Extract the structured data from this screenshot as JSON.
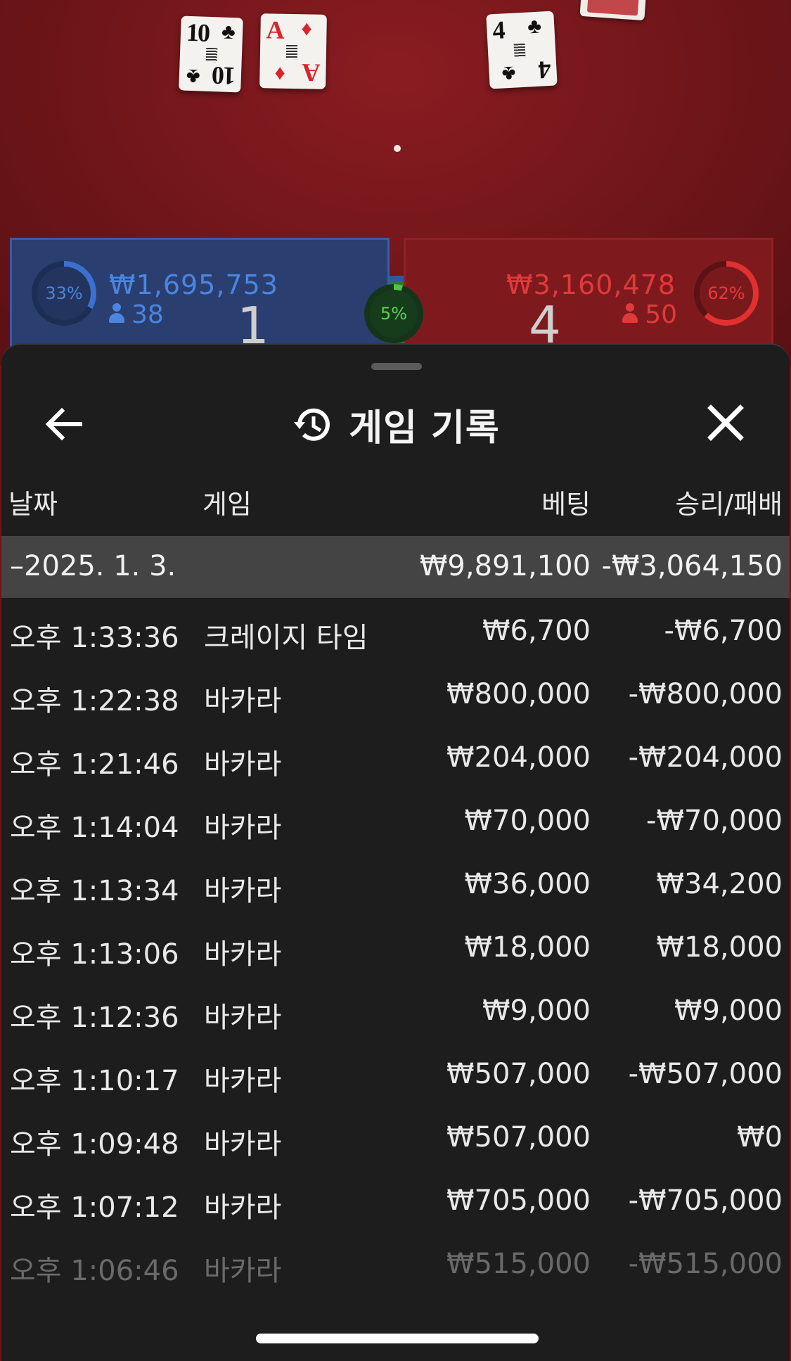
{
  "game": {
    "cards_left": [
      {
        "rank": "10",
        "suit": "♣",
        "color": "black"
      },
      {
        "rank": "A",
        "suit": "♦",
        "color": "red"
      }
    ],
    "cards_right": [
      {
        "rank": "4",
        "suit": "♣",
        "color": "black"
      }
    ],
    "player": {
      "percent": "33%",
      "amount": "₩1,695,753",
      "players": "38",
      "score": "1"
    },
    "tie": {
      "percent": "5%"
    },
    "banker": {
      "percent": "62%",
      "amount": "₩3,160,478",
      "players": "50",
      "score": "4"
    }
  },
  "sheet": {
    "title": "게임 기록",
    "back_icon": "back-arrow-icon",
    "history_icon": "history-icon",
    "close_icon": "close-icon",
    "columns": {
      "date": "날짜",
      "game": "게임",
      "bet": "베팅",
      "result": "승리/패배"
    },
    "summary": {
      "date": "–2025. 1. 3.",
      "bet": "₩9,891,100",
      "result": "-₩3,064,150"
    },
    "rows": [
      {
        "time": "오후 1:33:36",
        "game": "크레이지 타임",
        "bet": "₩6,700",
        "result": "-₩6,700"
      },
      {
        "time": "오후 1:22:38",
        "game": "바카라",
        "bet": "₩800,000",
        "result": "-₩800,000"
      },
      {
        "time": "오후 1:21:46",
        "game": "바카라",
        "bet": "₩204,000",
        "result": "-₩204,000"
      },
      {
        "time": "오후 1:14:04",
        "game": "바카라",
        "bet": "₩70,000",
        "result": "-₩70,000"
      },
      {
        "time": "오후 1:13:34",
        "game": "바카라",
        "bet": "₩36,000",
        "result": "₩34,200"
      },
      {
        "time": "오후 1:13:06",
        "game": "바카라",
        "bet": "₩18,000",
        "result": "₩18,000"
      },
      {
        "time": "오후 1:12:36",
        "game": "바카라",
        "bet": "₩9,000",
        "result": "₩9,000"
      },
      {
        "time": "오후 1:10:17",
        "game": "바카라",
        "bet": "₩507,000",
        "result": "-₩507,000"
      },
      {
        "time": "오후 1:09:48",
        "game": "바카라",
        "bet": "₩507,000",
        "result": "₩0"
      },
      {
        "time": "오후 1:07:12",
        "game": "바카라",
        "bet": "₩705,000",
        "result": "-₩705,000"
      },
      {
        "time": "오후 1:06:46",
        "game": "바카라",
        "bet": "₩515,000",
        "result": "-₩515,000"
      }
    ]
  }
}
